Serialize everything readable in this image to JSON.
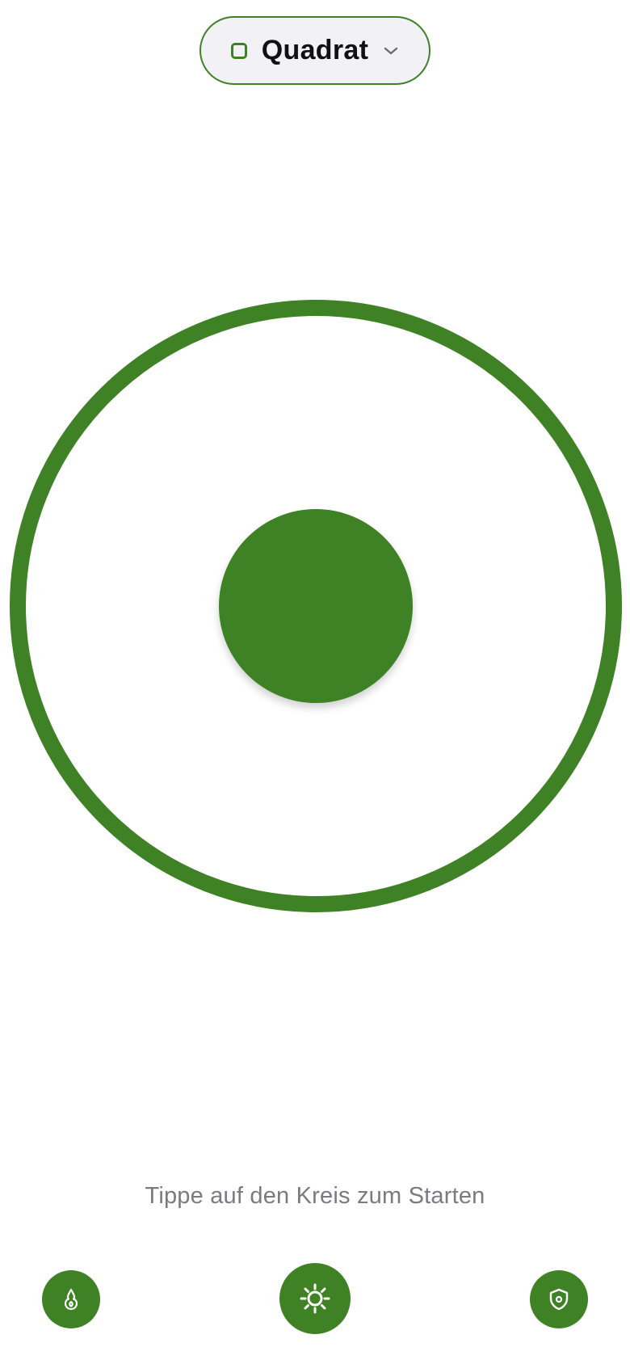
{
  "mode_selector": {
    "label": "Quadrat",
    "icon": "square-icon",
    "chevron": "chevron-down-icon"
  },
  "breathing_circle": {
    "outer_ring": "outer-ring",
    "inner_dot": "inner-dot"
  },
  "hint": {
    "text": "Tippe auf den Kreis zum Starten"
  },
  "bottom_bar": {
    "left_icon": "flame-icon",
    "center_icon": "sun-icon",
    "right_icon": "shield-icon"
  },
  "colors": {
    "accent": "#3f8226",
    "pill_background": "#f1f1f6",
    "hint_text": "#7a7a80",
    "background": "#ffffff"
  }
}
